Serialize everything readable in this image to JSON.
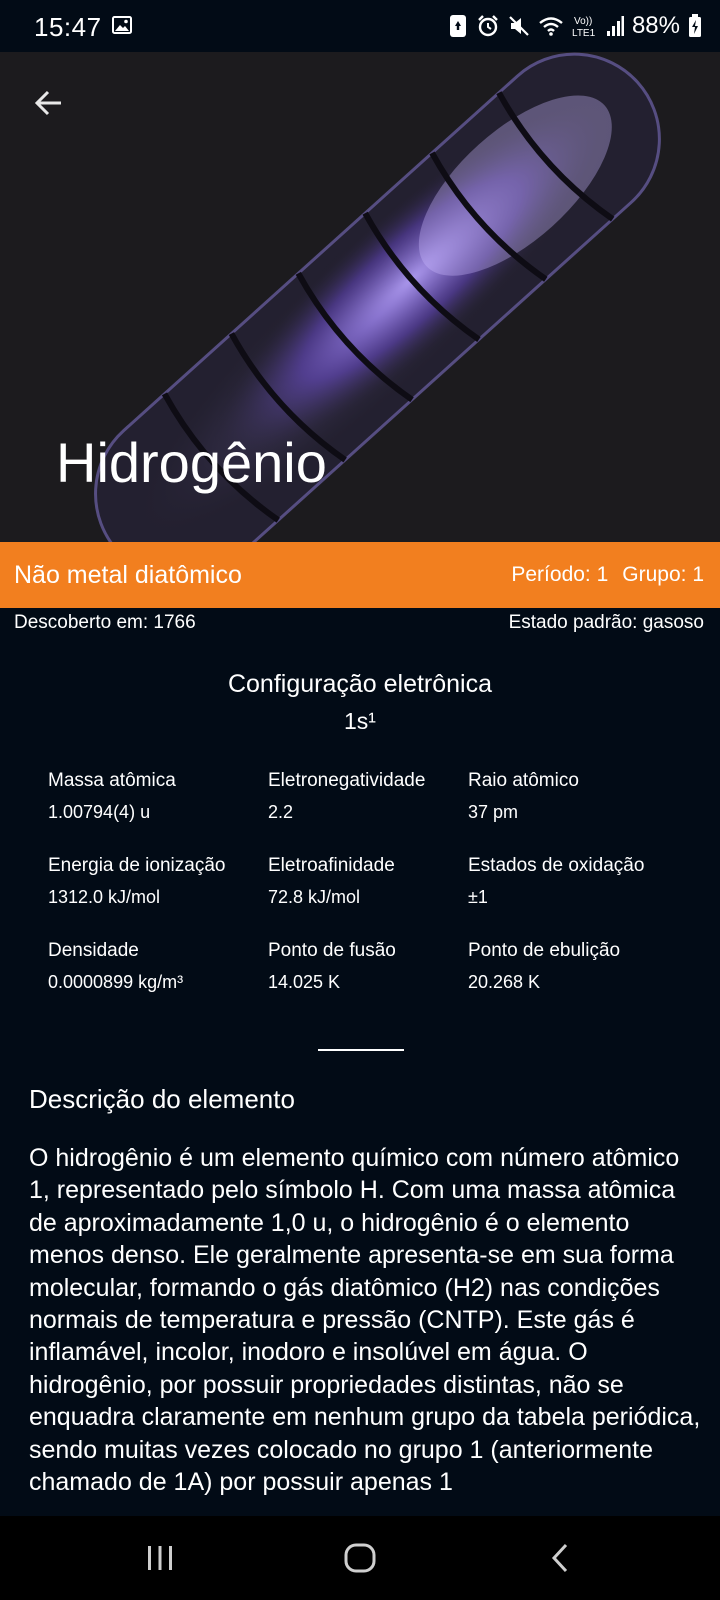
{
  "status_bar": {
    "time": "15:47",
    "battery": "88%",
    "icons": [
      "gallery-icon",
      "recycle-icon",
      "alarm-icon",
      "mute-icon",
      "wifi-icon",
      "volte-icon",
      "signal-icon",
      "battery-icon"
    ],
    "volte_label": "Vo)) LTE1"
  },
  "header": {
    "back_icon": "arrow-left-icon",
    "element_name": "Hidrogênio"
  },
  "category": {
    "name": "Não metal diatômico",
    "period": "Período: 1",
    "group": "Grupo: 1",
    "color": "#f27f1f"
  },
  "info": {
    "discovered": "Descoberto em: 1766",
    "standard_state": "Estado padrão: gasoso"
  },
  "electron_config": {
    "title": "Configuração eletrônica",
    "value": "1s¹"
  },
  "properties": [
    {
      "label": "Massa atômica",
      "value": "1.00794(4) u"
    },
    {
      "label": "Eletronegatividade",
      "value": "2.2"
    },
    {
      "label": "Raio atômico",
      "value": "37 pm"
    },
    {
      "label": "Energia de ionização",
      "value": "1312.0 kJ/mol"
    },
    {
      "label": "Eletroafinidade",
      "value": "72.8 kJ/mol"
    },
    {
      "label": "Estados de oxidação",
      "value": "±1"
    },
    {
      "label": "Densidade",
      "value": "0.0000899 kg/m³"
    },
    {
      "label": "Ponto de fusão",
      "value": "14.025 K"
    },
    {
      "label": "Ponto de ebulição",
      "value": "20.268 K"
    }
  ],
  "description": {
    "title": "Descrição do elemento",
    "text": "O hidrogênio é um elemento químico com número atômico 1, representado pelo símbolo H. Com uma massa atômica de aproximadamente 1,0 u, o hidrogênio é o elemento menos denso. Ele geralmente apresenta-se em sua forma molecular, formando o gás diatômico (H2) nas condições normais de temperatura e pressão (CNTP). Este gás é inflamável, incolor, inodoro e insolúvel em água. O hidrogênio, por possuir propriedades distintas, não se enquadra claramente em nenhum grupo da tabela periódica, sendo muitas vezes colocado no grupo 1 (anteriormente chamado de 1A) por possuir apenas 1"
  },
  "nav_bar": {
    "recents_icon": "recents-icon",
    "home_icon": "home-icon",
    "back_icon": "back-icon"
  }
}
